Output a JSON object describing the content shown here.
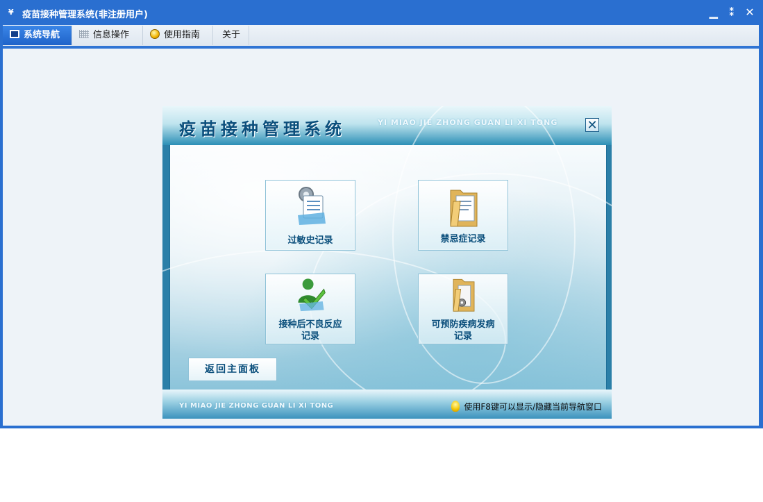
{
  "window": {
    "title": "疫苗接种管理系统(非注册用户)",
    "app_icon": "¥",
    "controls": {
      "minimize": "▁",
      "restore": "⁑",
      "close": "✕"
    }
  },
  "menubar": {
    "tabs": [
      {
        "label": "系统导航",
        "icon": "monitor-icon",
        "active": true
      },
      {
        "label": "信息操作",
        "icon": "grid-icon",
        "active": false
      },
      {
        "label": "使用指南",
        "icon": "help-circle-icon",
        "active": false
      },
      {
        "label": "关于",
        "icon": "",
        "active": false
      }
    ]
  },
  "panel": {
    "title": "疫苗接种管理系统",
    "subtitle": "YI MIAO JIE ZHONG GUAN LI XI TONG",
    "close": "✕",
    "tiles": [
      {
        "label": "过敏史记录",
        "icon": "document-gear-icon"
      },
      {
        "label": "禁忌症记录",
        "icon": "folder-document-icon"
      },
      {
        "label": "接种后不良反应记录",
        "line1": "接种后不良反应",
        "line2": "记录",
        "icon": "user-check-icon"
      },
      {
        "label": "可预防疾病发病记录",
        "line1": "可预防疾病发病",
        "line2": "记录",
        "icon": "folder-disc-icon"
      }
    ],
    "back_button": "返回主面板",
    "footer_left": "YI MIAO JIE ZHONG GUAN LI XI TONG",
    "footer_tip": "使用F8键可以显示/隐藏当前导航窗口"
  },
  "colors": {
    "titlebar": "#2a6fd0",
    "accent": "#0b4f7c",
    "content_bg": "#eef3f8"
  }
}
